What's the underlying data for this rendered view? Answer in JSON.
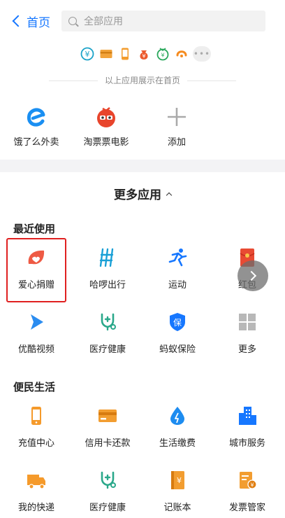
{
  "header": {
    "back_label": "首页",
    "search_placeholder": "全部应用"
  },
  "pinned": {
    "icons": [
      "yuebao-icon",
      "card-icon",
      "phone-icon",
      "money-bag-icon",
      "fortune-icon",
      "didi-icon"
    ],
    "more_label": "•••",
    "caption": "以上应用展示在首页"
  },
  "home_apps": [
    {
      "label": "饿了么外卖",
      "icon": "eleme-icon"
    },
    {
      "label": "淘票票电影",
      "icon": "taopiaopiao-icon"
    },
    {
      "label": "添加",
      "icon": "plus-icon"
    }
  ],
  "more_title": "更多应用",
  "recent": {
    "title": "最近使用",
    "items": [
      {
        "label": "爱心捐赠",
        "icon": "heart-leaf-icon"
      },
      {
        "label": "哈啰出行",
        "icon": "hellobike-icon"
      },
      {
        "label": "运动",
        "icon": "running-icon"
      },
      {
        "label": "红包",
        "icon": "red-envelope-icon"
      },
      {
        "label": "优酷视频",
        "icon": "youku-icon"
      },
      {
        "label": "医疗健康",
        "icon": "medical-icon"
      },
      {
        "label": "蚂蚁保险",
        "icon": "insurance-shield-icon"
      },
      {
        "label": "更多",
        "icon": "grid-icon"
      }
    ]
  },
  "convenience": {
    "title": "便民生活",
    "items": [
      {
        "label": "充值中心",
        "icon": "phone-icon"
      },
      {
        "label": "信用卡还款",
        "icon": "credit-card-icon"
      },
      {
        "label": "生活缴费",
        "icon": "water-drop-icon"
      },
      {
        "label": "城市服务",
        "icon": "city-buildings-icon"
      },
      {
        "label": "我的快递",
        "icon": "delivery-truck-icon"
      },
      {
        "label": "医疗健康",
        "icon": "medical-icon"
      },
      {
        "label": "记账本",
        "icon": "ledger-icon"
      },
      {
        "label": "发票管家",
        "icon": "invoice-icon"
      }
    ]
  }
}
